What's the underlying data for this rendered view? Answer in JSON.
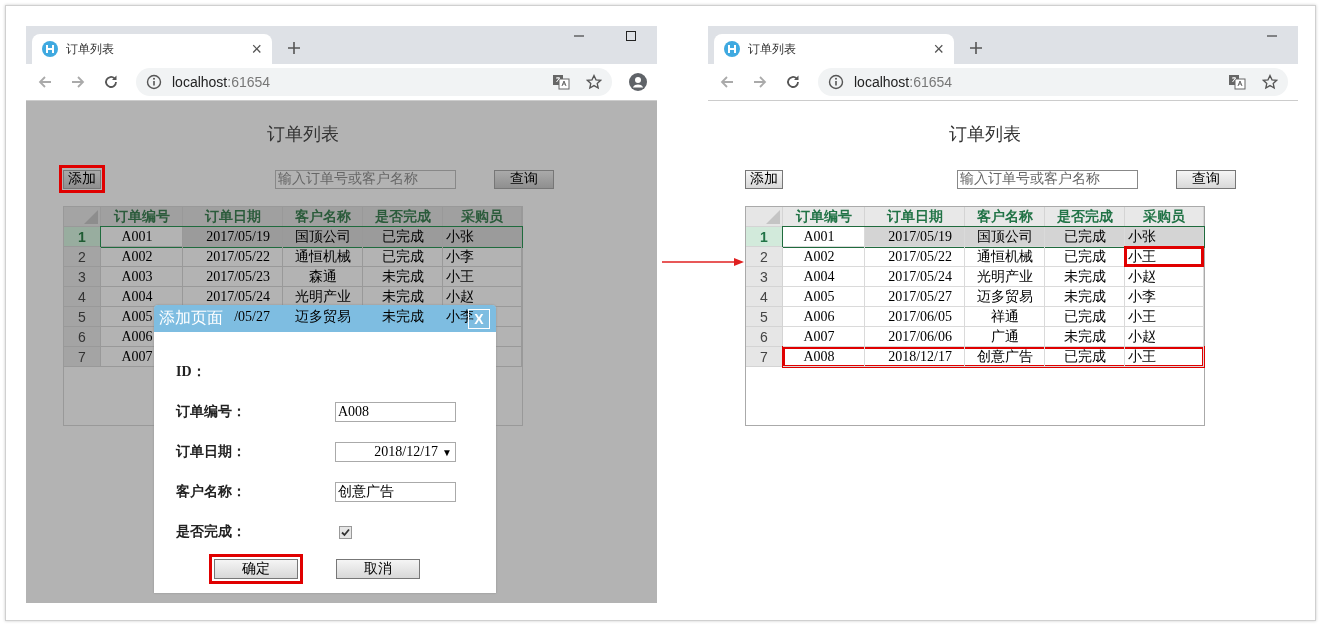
{
  "windows": [
    {
      "tab": {
        "title": "订单列表",
        "close": "×"
      },
      "window_buttons": [
        {
          "kind": "minimize"
        },
        {
          "kind": "maximize"
        }
      ],
      "url_host": "localhost",
      "url_port": ":61654",
      "address_icons": [
        {
          "kind": "translate"
        },
        {
          "kind": "star"
        }
      ],
      "toolbar_end_icons": [
        {
          "kind": "profile"
        }
      ],
      "page": {
        "dimmed": true,
        "title": "订单列表",
        "add_button": {
          "label": "添加",
          "highlighted": true
        },
        "search": {
          "placeholder": "输入订单号或客户名称"
        },
        "query_button": "查询",
        "table": {
          "columns": [
            "订单编号",
            "订单日期",
            "客户名称",
            "是否完成",
            "采购员"
          ],
          "rows": [
            {
              "number": "1",
              "selected": true,
              "highlighted": false,
              "last_cell_highlighted": false,
              "cells": [
                "A001",
                "2017/05/19",
                "国顶公司",
                "已完成",
                "小张"
              ]
            },
            {
              "number": "2",
              "selected": false,
              "highlighted": false,
              "last_cell_highlighted": false,
              "cells": [
                "A002",
                "2017/05/22",
                "通恒机械",
                "已完成",
                "小李"
              ]
            },
            {
              "number": "3",
              "selected": false,
              "highlighted": false,
              "last_cell_highlighted": false,
              "cells": [
                "A003",
                "2017/05/23",
                "森通",
                "未完成",
                "小王"
              ]
            },
            {
              "number": "4",
              "selected": false,
              "highlighted": false,
              "last_cell_highlighted": false,
              "cells": [
                "A004",
                "2017/05/24",
                "光明产业",
                "未完成",
                "小赵"
              ]
            },
            {
              "number": "5",
              "selected": false,
              "highlighted": false,
              "last_cell_highlighted": false,
              "cells": [
                "A005",
                "/05/27",
                "迈多贸易",
                "未完成",
                "小李"
              ]
            },
            {
              "number": "6",
              "selected": false,
              "highlighted": false,
              "last_cell_highlighted": false,
              "cells": [
                "A006"
              ]
            },
            {
              "number": "7",
              "selected": false,
              "highlighted": false,
              "last_cell_highlighted": false,
              "cells": [
                "A007"
              ]
            }
          ]
        },
        "dialog": {
          "title": "添加页面",
          "close": "X",
          "fields": [
            {
              "kind": "none",
              "label": "ID："
            },
            {
              "kind": "text",
              "label": "订单编号：",
              "value": "A008"
            },
            {
              "kind": "date",
              "label": "订单日期：",
              "value": "2018/12/17",
              "dropdown_glyph": "▼"
            },
            {
              "kind": "text",
              "label": "客户名称：",
              "value": "创意广告"
            },
            {
              "kind": "checkbox",
              "label": "是否完成：",
              "checked": true
            }
          ],
          "buttons": [
            {
              "label": "确定",
              "highlighted": true
            },
            {
              "label": "取消",
              "highlighted": false
            }
          ]
        }
      }
    },
    {
      "tab": {
        "title": "订单列表",
        "close": "×"
      },
      "window_buttons": [
        {
          "kind": "minimize"
        }
      ],
      "url_host": "localhost",
      "url_port": ":61654",
      "address_icons": [
        {
          "kind": "translate"
        },
        {
          "kind": "star"
        }
      ],
      "page": {
        "dimmed": false,
        "title": "订单列表",
        "add_button": {
          "label": "添加",
          "highlighted": false
        },
        "search": {
          "placeholder": "输入订单号或客户名称"
        },
        "query_button": "查询",
        "table": {
          "columns": [
            "订单编号",
            "订单日期",
            "客户名称",
            "是否完成",
            "采购员"
          ],
          "rows": [
            {
              "number": "1",
              "selected": true,
              "highlighted": false,
              "last_cell_highlighted": false,
              "cells": [
                "A001",
                "2017/05/19",
                "国顶公司",
                "已完成",
                "小张"
              ]
            },
            {
              "number": "2",
              "selected": false,
              "highlighted": false,
              "last_cell_highlighted": true,
              "cells": [
                "A002",
                "2017/05/22",
                "通恒机械",
                "已完成",
                "小王"
              ]
            },
            {
              "number": "3",
              "selected": false,
              "highlighted": false,
              "last_cell_highlighted": false,
              "cells": [
                "A004",
                "2017/05/24",
                "光明产业",
                "未完成",
                "小赵"
              ]
            },
            {
              "number": "4",
              "selected": false,
              "highlighted": false,
              "last_cell_highlighted": false,
              "cells": [
                "A005",
                "2017/05/27",
                "迈多贸易",
                "未完成",
                "小李"
              ]
            },
            {
              "number": "5",
              "selected": false,
              "highlighted": false,
              "last_cell_highlighted": false,
              "cells": [
                "A006",
                "2017/06/05",
                "祥通",
                "已完成",
                "小王"
              ]
            },
            {
              "number": "6",
              "selected": false,
              "highlighted": false,
              "last_cell_highlighted": false,
              "cells": [
                "A007",
                "2017/06/06",
                "广通",
                "未完成",
                "小赵"
              ]
            },
            {
              "number": "7",
              "selected": false,
              "highlighted": true,
              "last_cell_highlighted": false,
              "cells": [
                "A008",
                "2018/12/17",
                "创意广告",
                "已完成",
                "小王"
              ]
            }
          ]
        }
      }
    }
  ]
}
